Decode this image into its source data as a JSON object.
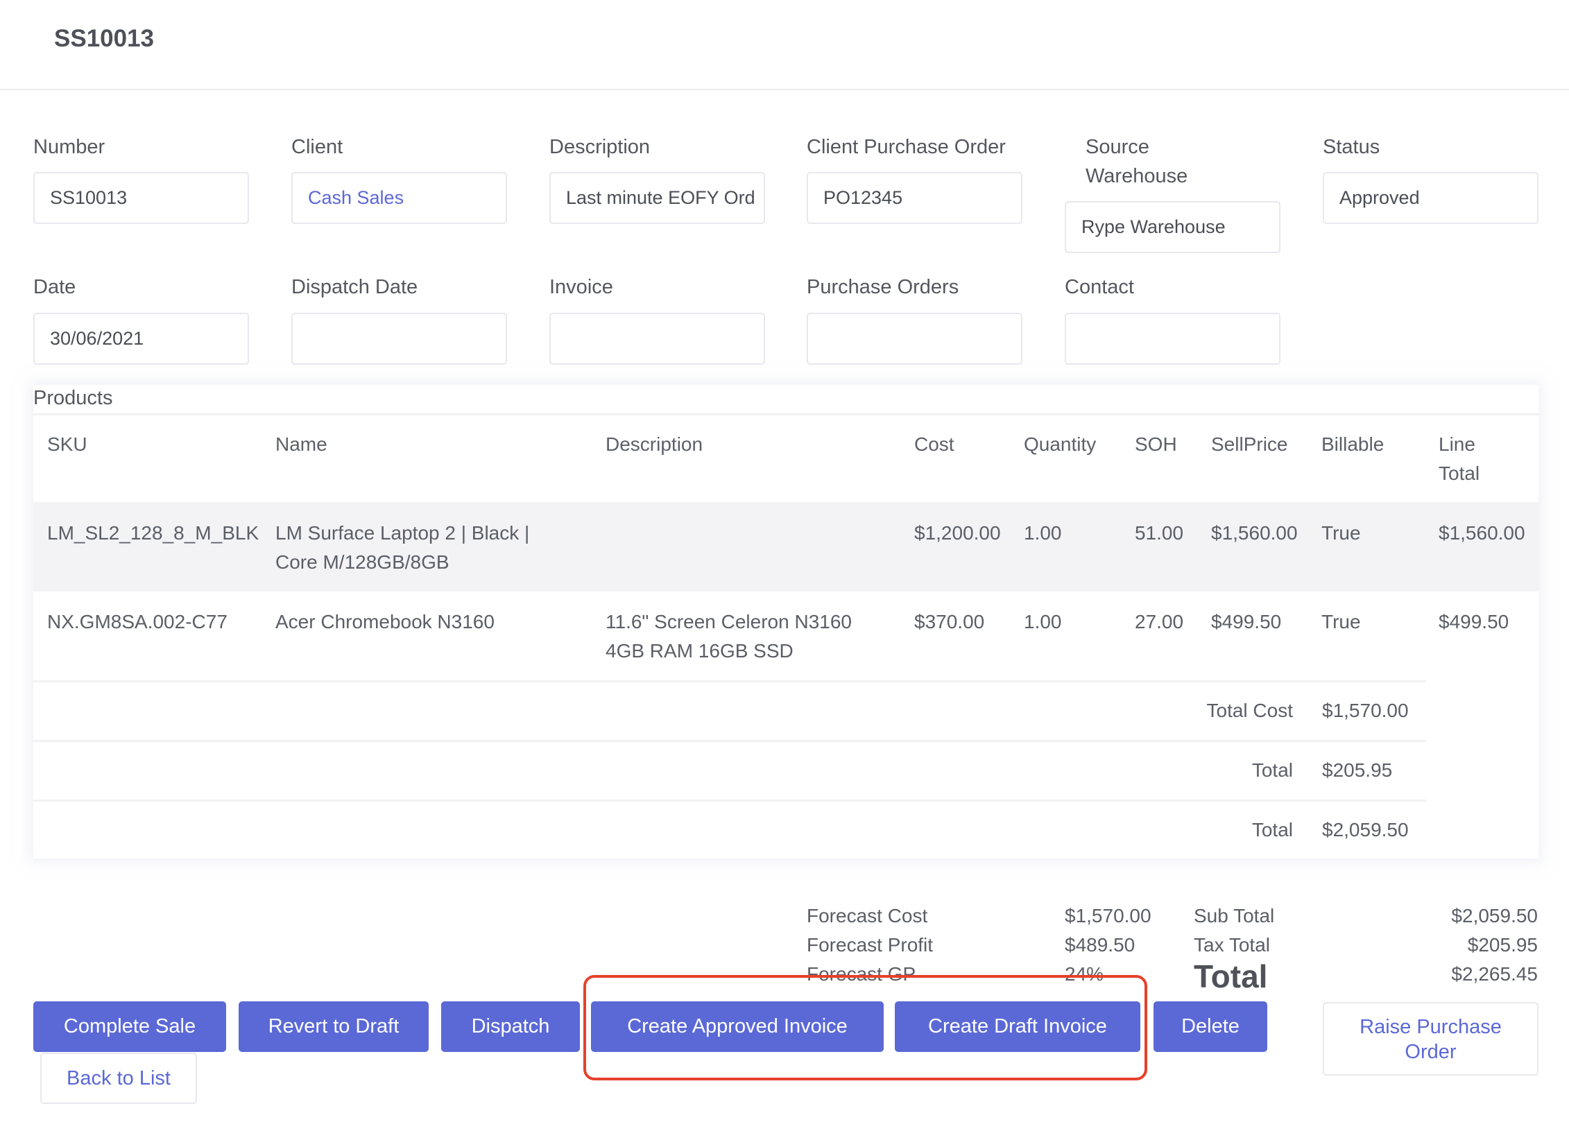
{
  "header": {
    "title": "SS10013"
  },
  "fields": {
    "number": {
      "label": "Number",
      "value": "SS10013"
    },
    "client": {
      "label": "Client",
      "value": "Cash Sales"
    },
    "description": {
      "label": "Description",
      "value": "Last  minute EOFY Ord"
    },
    "client_po": {
      "label": "Client Purchase Order",
      "value": "PO12345"
    },
    "source_warehouse": {
      "label_line1": "Source",
      "label_line2": "Warehouse",
      "value": "Rype Warehouse"
    },
    "status": {
      "label": "Status",
      "value": "Approved"
    },
    "date": {
      "label": "Date",
      "value": "30/06/2021"
    },
    "dispatch_date": {
      "label": "Dispatch Date",
      "value": ""
    },
    "invoice": {
      "label": "Invoice",
      "value": ""
    },
    "purchase_orders": {
      "label": "Purchase Orders",
      "value": ""
    },
    "contact": {
      "label": "Contact",
      "value": ""
    }
  },
  "products": {
    "title": "Products",
    "columns": [
      "SKU",
      "Name",
      "Description",
      "Cost",
      "Quantity",
      "SOH",
      "SellPrice",
      "Billable",
      "Line",
      "Total"
    ],
    "rows": [
      {
        "sku": "LM_SL2_128_8_M_BLK",
        "name_line1": "LM Surface Laptop 2 | Black |",
        "name_line2": "Core M/128GB/8GB",
        "desc_line1": "",
        "desc_line2": "",
        "cost": "$1,200.00",
        "quantity": "1.00",
        "soh": "51.00",
        "sell_price": "$1,560.00",
        "billable": "True",
        "line_total": "$1,560.00"
      },
      {
        "sku": "NX.GM8SA.002-C77",
        "name_line1": "Acer Chromebook N3160",
        "name_line2": "",
        "desc_line1": "11.6\" Screen Celeron N3160",
        "desc_line2": "4GB RAM 16GB SSD",
        "cost": "$370.00",
        "quantity": "1.00",
        "soh": "27.00",
        "sell_price": "$499.50",
        "billable": "True",
        "line_total": "$499.50"
      }
    ],
    "summary": [
      {
        "label": "Total Cost",
        "value": "$1,570.00"
      },
      {
        "label": "Total",
        "value": "$205.95"
      },
      {
        "label": "Total",
        "value": "$2,059.50"
      }
    ]
  },
  "forecast": {
    "cost_label": "Forecast Cost",
    "cost_value": "$1,570.00",
    "profit_label": "Forecast Profit",
    "profit_value": "$489.50",
    "gp_label": "Forecast GP",
    "gp_value": "24%"
  },
  "totals": {
    "subtotal_label": "Sub Total",
    "subtotal_value": "$2,059.50",
    "tax_label": "Tax Total",
    "tax_value": "$205.95",
    "total_label": "Total",
    "total_value": "$2,265.45"
  },
  "actions": {
    "complete_sale": "Complete Sale",
    "revert_to_draft": "Revert to Draft",
    "dispatch": "Dispatch",
    "create_approved_invoice": "Create Approved Invoice",
    "create_draft_invoice": "Create Draft Invoice",
    "delete": "Delete",
    "raise_po_line1": "Raise Purchase",
    "raise_po_line2": "Order",
    "back_to_list": "Back to List"
  },
  "colors": {
    "accent": "#5b69d6",
    "annotation": "#e5412b",
    "row_highlight": "#f3f3f6"
  }
}
